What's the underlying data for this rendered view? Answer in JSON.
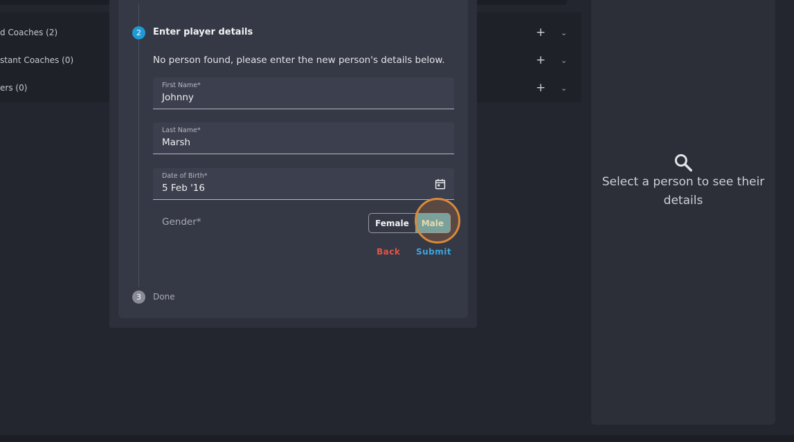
{
  "background_list": {
    "rows": [
      {
        "label": "d Coaches (2)"
      },
      {
        "label": "stant Coaches (0)"
      },
      {
        "label": "ers (0)"
      }
    ],
    "plus_glyph": "+",
    "chevron_glyph": "⌄"
  },
  "detail_panel": {
    "icon": "search-icon",
    "message": "Select a person to see their details"
  },
  "modal": {
    "step2": {
      "number": "2",
      "title": "Enter player details"
    },
    "step3": {
      "number": "3",
      "title": "Done"
    },
    "info_text": "No person found, please enter the new person's details below.",
    "fields": {
      "first_name": {
        "label": "First Name*",
        "value": "Johnny"
      },
      "last_name": {
        "label": "Last Name*",
        "value": "Marsh"
      },
      "dob": {
        "label": "Date of Birth*",
        "value": "5 Feb '16",
        "icon": "calendar-icon"
      }
    },
    "gender": {
      "label": "Gender*",
      "options": [
        "Female",
        "Male"
      ],
      "selected": "Male"
    },
    "actions": {
      "back_label": "Back",
      "submit_label": "Submit"
    }
  },
  "colors": {
    "accent_blue": "#1e9ad6",
    "back_red": "#e05548",
    "submit_blue": "#3ba6e0",
    "selected_male": "#5fa8b6",
    "highlight_orange": "#d98a3a"
  }
}
